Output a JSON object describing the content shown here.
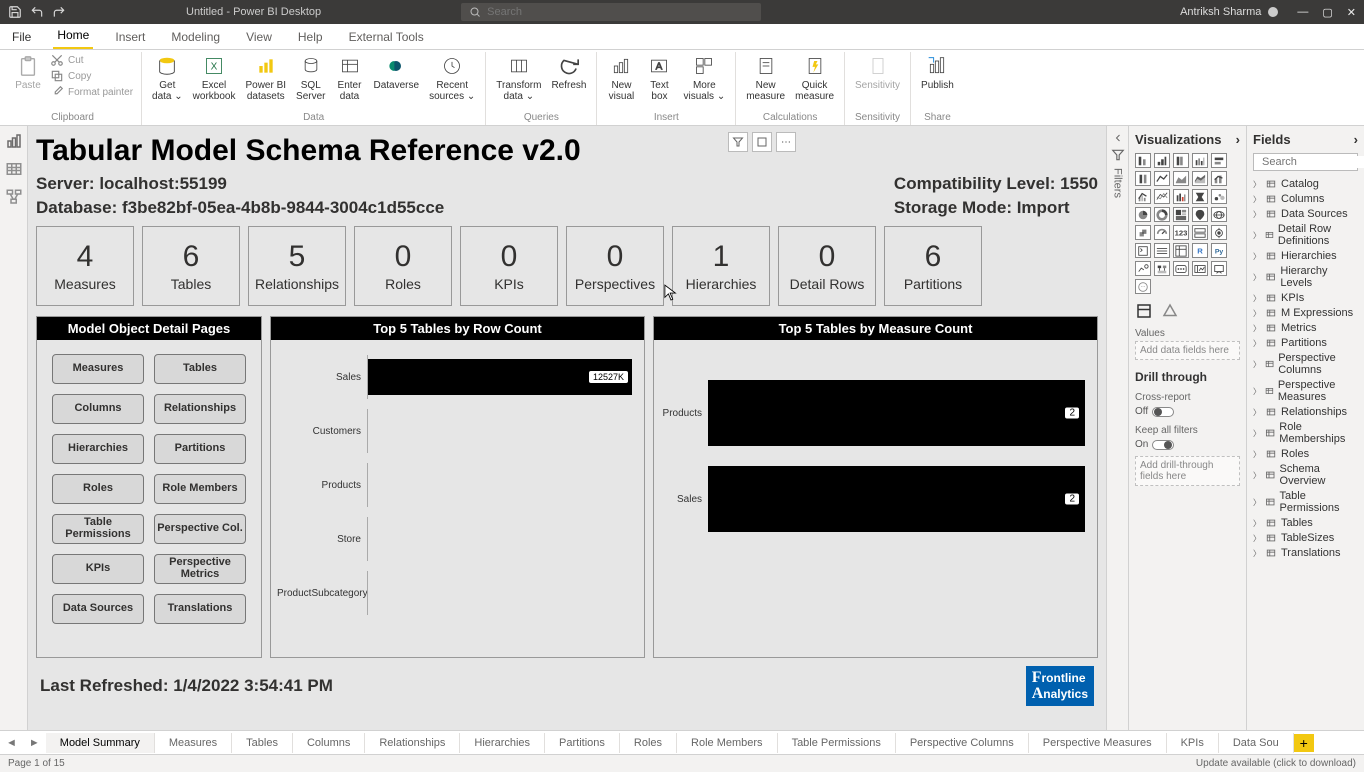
{
  "titlebar": {
    "title": "Untitled - Power BI Desktop",
    "search_placeholder": "Search",
    "user": "Antriksh Sharma"
  },
  "ribbon_tabs": [
    "File",
    "Home",
    "Insert",
    "Modeling",
    "View",
    "Help",
    "External Tools"
  ],
  "ribbon_tabs_active": 1,
  "ribbon": {
    "clipboard": {
      "paste": "Paste",
      "cut": "Cut",
      "copy": "Copy",
      "format_painter": "Format painter",
      "label": "Clipboard"
    },
    "data": {
      "get_data": "Get\ndata ⌄",
      "excel": "Excel\nworkbook",
      "pbi_datasets": "Power BI\ndatasets",
      "sql": "SQL\nServer",
      "enter": "Enter\ndata",
      "dataverse": "Dataverse",
      "recent": "Recent\nsources ⌄",
      "label": "Data"
    },
    "queries": {
      "transform": "Transform\ndata ⌄",
      "refresh": "Refresh",
      "label": "Queries"
    },
    "insert": {
      "new_visual": "New\nvisual",
      "text_box": "Text\nbox",
      "more_visuals": "More\nvisuals ⌄",
      "label": "Insert"
    },
    "calc": {
      "new_measure": "New\nmeasure",
      "quick_measure": "Quick\nmeasure",
      "label": "Calculations"
    },
    "sens": {
      "sensitivity": "Sensitivity\n ",
      "label": "Sensitivity"
    },
    "share": {
      "publish": "Publish",
      "label": "Share"
    }
  },
  "report": {
    "title": "Tabular Model Schema Reference v2.0",
    "server_label": "Server: localhost:55199",
    "database_label": "Database: f3be82bf-05ea-4b8b-9844-3004c1d55cce",
    "compat_label": "Compatibility Level: 1550",
    "storage_label": "Storage Mode: Import",
    "refreshed": "Last Refreshed: 1/4/2022 3:54:41 PM",
    "logo_l1": "rontline",
    "logo_l2": "nalytics",
    "cards": [
      {
        "val": "4",
        "lbl": "Measures"
      },
      {
        "val": "6",
        "lbl": "Tables"
      },
      {
        "val": "5",
        "lbl": "Relationships"
      },
      {
        "val": "0",
        "lbl": "Roles"
      },
      {
        "val": "0",
        "lbl": "KPIs"
      },
      {
        "val": "0",
        "lbl": "Perspectives"
      },
      {
        "val": "1",
        "lbl": "Hierarchies"
      },
      {
        "val": "0",
        "lbl": "Detail Rows"
      },
      {
        "val": "6",
        "lbl": "Partitions"
      }
    ],
    "nav_title": "Model Object Detail Pages",
    "nav_buttons": [
      "Measures",
      "Tables",
      "Columns",
      "Relationships",
      "Hierarchies",
      "Partitions",
      "Roles",
      "Role Members",
      "Table Permissions",
      "Perspective Col.",
      "KPIs",
      "Perspective Metrics",
      "Data Sources",
      "Translations"
    ],
    "chart1_title": "Top 5 Tables by Row Count",
    "chart2_title": "Top 5 Tables by Measure Count"
  },
  "chart_data": [
    {
      "type": "bar",
      "orientation": "horizontal",
      "title": "Top 5 Tables by Row Count",
      "categories": [
        "Sales",
        "Customers",
        "Products",
        "Store",
        "ProductSubcategory"
      ],
      "values": [
        12527000,
        null,
        null,
        null,
        null
      ],
      "value_labels": [
        "12527K",
        "",
        "",
        "",
        ""
      ],
      "bar_pct": [
        100,
        0,
        0,
        0,
        0
      ]
    },
    {
      "type": "bar",
      "orientation": "horizontal",
      "title": "Top 5 Tables by Measure Count",
      "categories": [
        "Products",
        "Sales"
      ],
      "values": [
        2,
        2
      ],
      "bar_pct": [
        100,
        100
      ]
    }
  ],
  "viz_pane": {
    "header": "Visualizations",
    "values_label": "Values",
    "values_well": "Add data fields here",
    "drill_header": "Drill through",
    "cross_report": "Cross-report",
    "off": "Off",
    "keep_filters": "Keep all filters",
    "on": "On",
    "drill_well": "Add drill-through fields here"
  },
  "fields_pane": {
    "header": "Fields",
    "search_placeholder": "Search",
    "tables": [
      "Catalog",
      "Columns",
      "Data Sources",
      "Detail Row Definitions",
      "Hierarchies",
      "Hierarchy Levels",
      "KPIs",
      "M Expressions",
      "Metrics",
      "Partitions",
      "Perspective Columns",
      "Perspective Measures",
      "Relationships",
      "Role Memberships",
      "Roles",
      "Schema Overview",
      "Table Permissions",
      "Tables",
      "TableSizes",
      "Translations"
    ]
  },
  "filters_label": "Filters",
  "page_tabs": [
    "Model Summary",
    "Measures",
    "Tables",
    "Columns",
    "Relationships",
    "Hierarchies",
    "Partitions",
    "Roles",
    "Role Members",
    "Table Permissions",
    "Perspective Columns",
    "Perspective Measures",
    "KPIs",
    "Data Sou"
  ],
  "page_tabs_active": 0,
  "status": {
    "page": "Page 1 of 15",
    "update": "Update available (click to download)"
  }
}
